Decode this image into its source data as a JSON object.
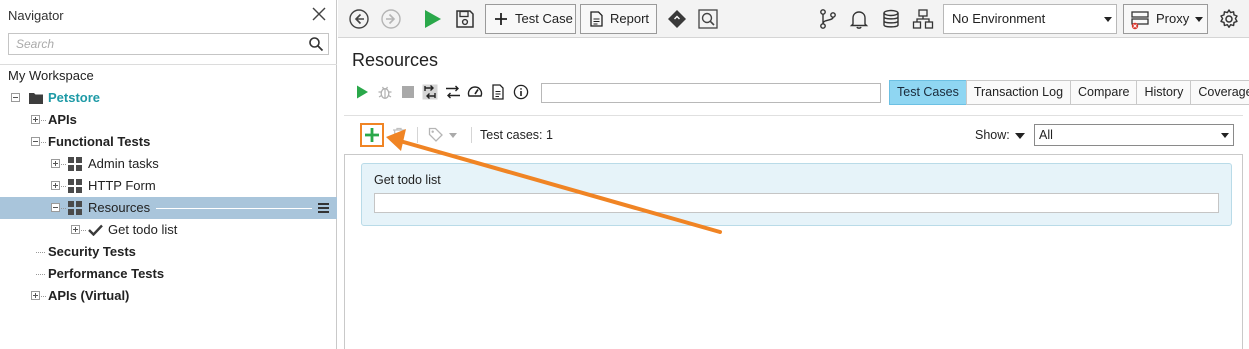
{
  "navigator": {
    "title": "Navigator",
    "search_placeholder": "Search",
    "workspace": "My Workspace",
    "project": "Petstore",
    "tree": {
      "apis": "APIs",
      "functional_tests": "Functional Tests",
      "admin_tasks": "Admin tasks",
      "http_form": "HTTP Form",
      "resources": "Resources",
      "get_todo_list": "Get todo list",
      "security_tests": "Security Tests",
      "performance_tests": "Performance Tests",
      "apis_virtual": "APIs (Virtual)"
    }
  },
  "toolbar": {
    "test_case_label": "Test Case",
    "report_label": "Report",
    "environment": "No Environment",
    "proxy_label": "Proxy",
    "icons": [
      "back-icon",
      "forward-icon",
      "run-icon",
      "save-icon",
      "plus-icon",
      "report-icon",
      "diamond-icon",
      "search-web-icon",
      "branch-icon",
      "bell-icon",
      "database-icon",
      "network-icon",
      "proxy-icon",
      "gear-icon"
    ]
  },
  "main": {
    "title": "Resources",
    "tabs": [
      {
        "label": "Test Cases",
        "active": true
      },
      {
        "label": "Transaction Log",
        "active": false
      },
      {
        "label": "Compare",
        "active": false
      },
      {
        "label": "History",
        "active": false
      },
      {
        "label": "Coverage",
        "active": false
      }
    ],
    "test_cases_count": "Test cases: 1",
    "show_label": "Show:",
    "show_value": "All",
    "test_cases": [
      {
        "name": "Get todo list"
      }
    ]
  },
  "colors": {
    "accent_green": "#2aa84a",
    "highlight_orange": "#f08424",
    "selected_row": "#a9c5db",
    "active_tab": "#8fd6f2",
    "project_teal": "#1e9aa6"
  }
}
